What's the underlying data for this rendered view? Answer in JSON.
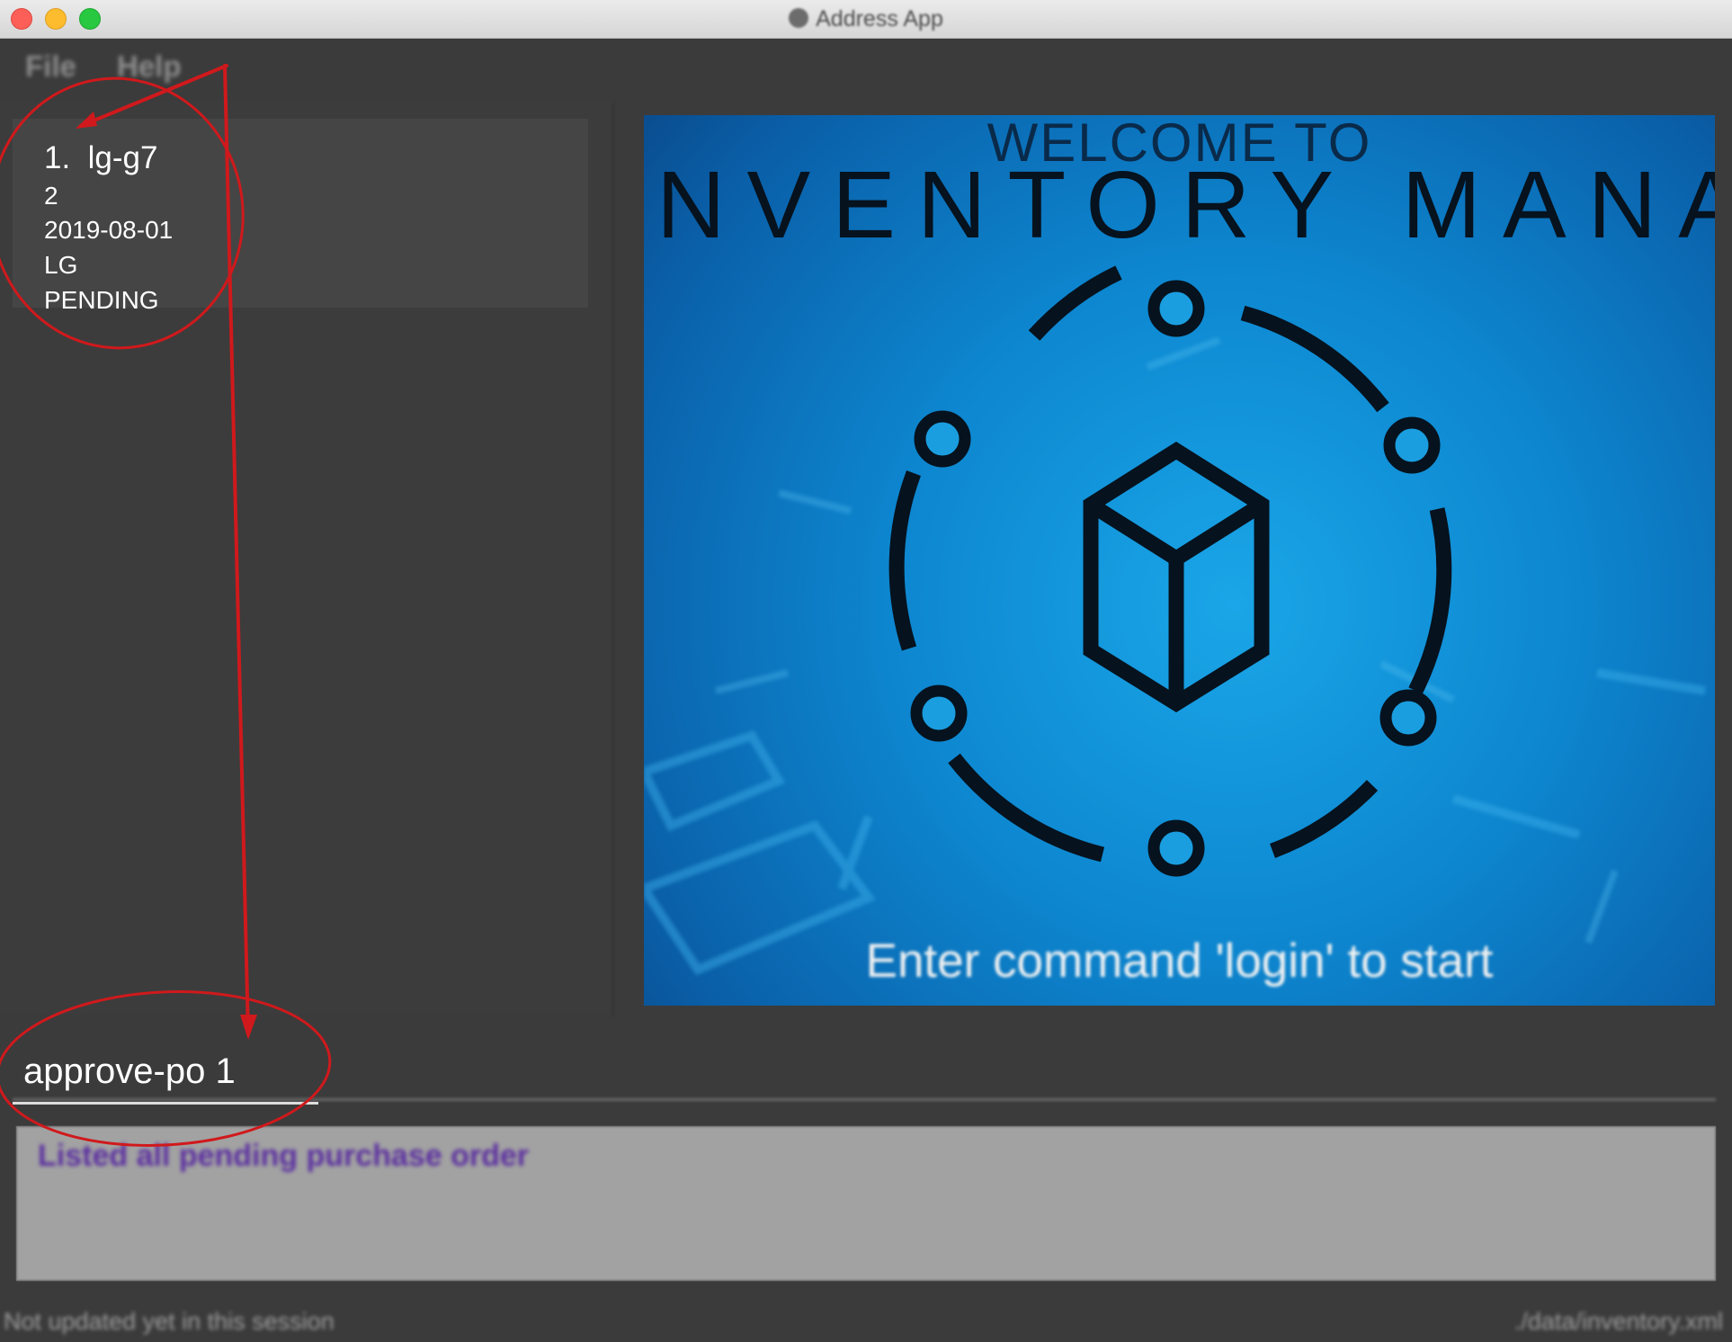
{
  "window": {
    "title": "Address App"
  },
  "menu": {
    "items": [
      {
        "label": "File"
      },
      {
        "label": "Help"
      }
    ]
  },
  "purchase_orders": [
    {
      "index": "1.",
      "sku": "lg-g7",
      "quantity": "2",
      "date": "2019-08-01",
      "supplier": "LG",
      "status": "PENDING"
    }
  ],
  "welcome": {
    "top_text": "WELCOME TO",
    "heading": "NVENTORY MANAGER",
    "footer": "Enter command 'login' to start",
    "colors": {
      "background": "#0d86cf",
      "icon": "#06121e",
      "footer_text": "#f2f2f2"
    },
    "icon": "cube-network-icon"
  },
  "command_box": {
    "value": "approve-po 1"
  },
  "result_display": {
    "text": "Listed all pending purchase order",
    "text_color": "#5b2fa0"
  },
  "status_bar": {
    "sync_status": "Not updated yet in this session",
    "save_location": "./data/inventory.xml"
  },
  "annotation": {
    "color": "#d0191c"
  }
}
